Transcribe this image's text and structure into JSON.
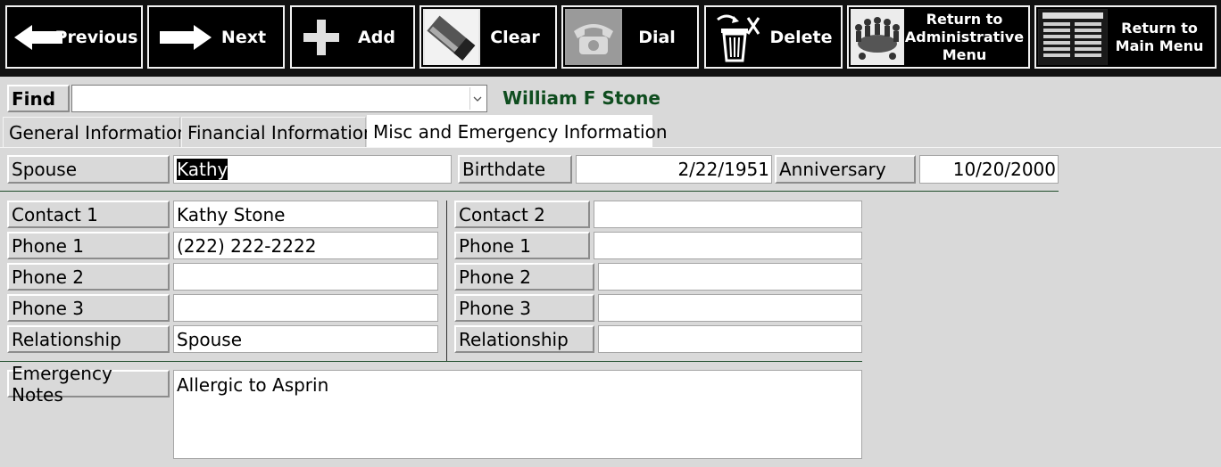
{
  "toolbar": {
    "previous": "Previous",
    "next": "Next",
    "add": "Add",
    "clear": "Clear",
    "dial": "Dial",
    "delete": "Delete",
    "return_admin": "Return to\nAdministrative\nMenu",
    "return_main": "Return to\nMain Menu"
  },
  "find": {
    "label": "Find",
    "value": "",
    "person_name": "William F Stone",
    "name_color": "#0f4d1f"
  },
  "tabs": [
    {
      "label": "General Information",
      "active": false
    },
    {
      "label": "Financial Information",
      "active": false
    },
    {
      "label": "Misc and Emergency Information",
      "active": true
    }
  ],
  "misc": {
    "spouse_label": "Spouse",
    "spouse_value": "Kathy",
    "birthdate_label": "Birthdate",
    "birthdate_value": "2/22/1951",
    "anniversary_label": "Anniversary",
    "anniversary_value": "10/20/2000"
  },
  "contact1": {
    "contact_label": "Contact 1",
    "contact_value": "Kathy Stone",
    "phone1_label": "Phone 1",
    "phone1_value": "(222) 222-2222",
    "phone2_label": "Phone 2",
    "phone2_value": "",
    "phone3_label": "Phone 3",
    "phone3_value": "",
    "relationship_label": "Relationship",
    "relationship_value": "Spouse"
  },
  "contact2": {
    "contact_label": "Contact 2",
    "contact_value": "",
    "phone1_label": "Phone 1",
    "phone1_value": "",
    "phone2_label": "Phone 2",
    "phone2_value": "",
    "phone3_label": "Phone 3",
    "phone3_value": "",
    "relationship_label": "Relationship",
    "relationship_value": ""
  },
  "emergency": {
    "label": "Emergency Notes",
    "value": "Allergic to Asprin"
  }
}
